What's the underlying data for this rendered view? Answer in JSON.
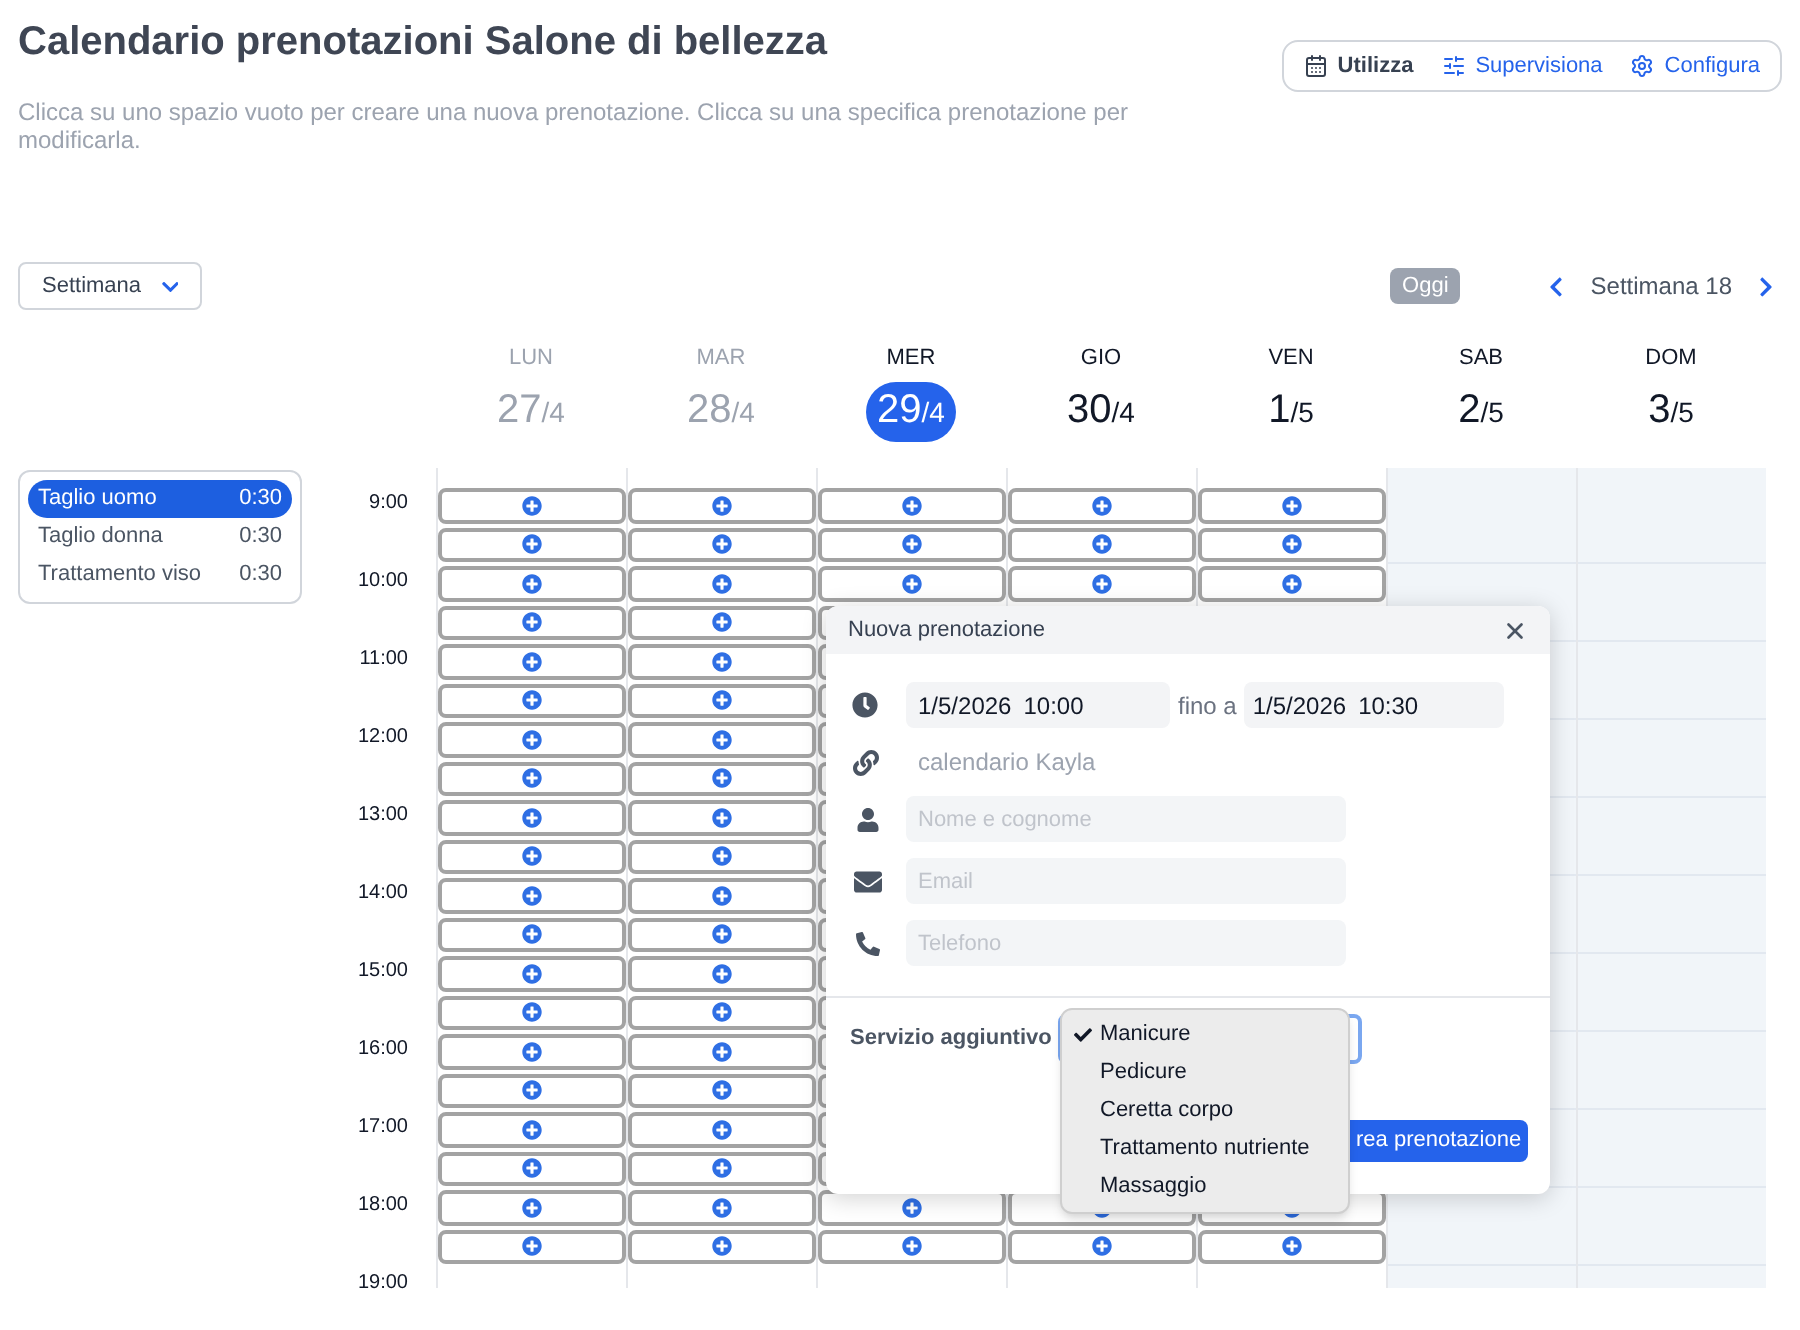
{
  "title": "Calendario prenotazioni Salone di bellezza",
  "subtitle": "Clicca su uno spazio vuoto per creare una nuova prenotazione. Clicca su una specifica prenotazione per modificarla.",
  "toolbar": [
    {
      "label": "Utilizza",
      "selected": true,
      "kind": "calendar"
    },
    {
      "label": "Supervisiona",
      "selected": false,
      "kind": "sliders"
    },
    {
      "label": "Configura",
      "selected": false,
      "kind": "gear"
    }
  ],
  "view_select": {
    "value": "Settimana"
  },
  "navigation": {
    "today": "Oggi",
    "week": "Settimana 18"
  },
  "days": [
    {
      "weekday": "LUN",
      "day": "27",
      "month": "/4",
      "past": true,
      "selected": false,
      "bookable": true
    },
    {
      "weekday": "MAR",
      "day": "28",
      "month": "/4",
      "past": true,
      "selected": false,
      "bookable": true
    },
    {
      "weekday": "MER",
      "day": "29",
      "month": "/4",
      "past": false,
      "selected": true,
      "bookable": true
    },
    {
      "weekday": "GIO",
      "day": "30",
      "month": "/4",
      "past": false,
      "selected": false,
      "bookable": true
    },
    {
      "weekday": "VEN",
      "day": "1",
      "month": "/5",
      "past": false,
      "selected": false,
      "bookable": true
    },
    {
      "weekday": "SAB",
      "day": "2",
      "month": "/5",
      "past": false,
      "selected": false,
      "bookable": false
    },
    {
      "weekday": "DOM",
      "day": "3",
      "month": "/5",
      "past": false,
      "selected": false,
      "bookable": false
    }
  ],
  "services": [
    {
      "name": "Taglio uomo",
      "duration": "0:30",
      "selected": true
    },
    {
      "name": "Taglio donna",
      "duration": "0:30",
      "selected": false
    },
    {
      "name": "Trattamento viso",
      "duration": "0:30",
      "selected": false
    }
  ],
  "hours": [
    "9:00",
    "10:00",
    "11:00",
    "12:00",
    "13:00",
    "14:00",
    "15:00",
    "16:00",
    "17:00",
    "18:00",
    "19:00"
  ],
  "popup": {
    "title": "Nuova prenotazione",
    "start_date": "1/5/2026",
    "start_time": "10:00",
    "until": "fino a",
    "end_date": "1/5/2026",
    "end_time": "10:30",
    "calendar": "calendario Kayla",
    "fields": [
      {
        "kind": "person",
        "placeholder": "Nome e cognome"
      },
      {
        "kind": "email",
        "placeholder": "Email"
      },
      {
        "kind": "phone",
        "placeholder": "Telefono"
      }
    ],
    "extra_service": {
      "label": "Servizio aggiuntivo",
      "options": [
        {
          "label": "Manicure",
          "selected": true
        },
        {
          "label": "Pedicure",
          "selected": false
        },
        {
          "label": "Ceretta corpo",
          "selected": false
        },
        {
          "label": "Trattamento nutriente",
          "selected": false
        },
        {
          "label": "Massaggio",
          "selected": false
        }
      ]
    },
    "submit": "rea prenotazione"
  }
}
